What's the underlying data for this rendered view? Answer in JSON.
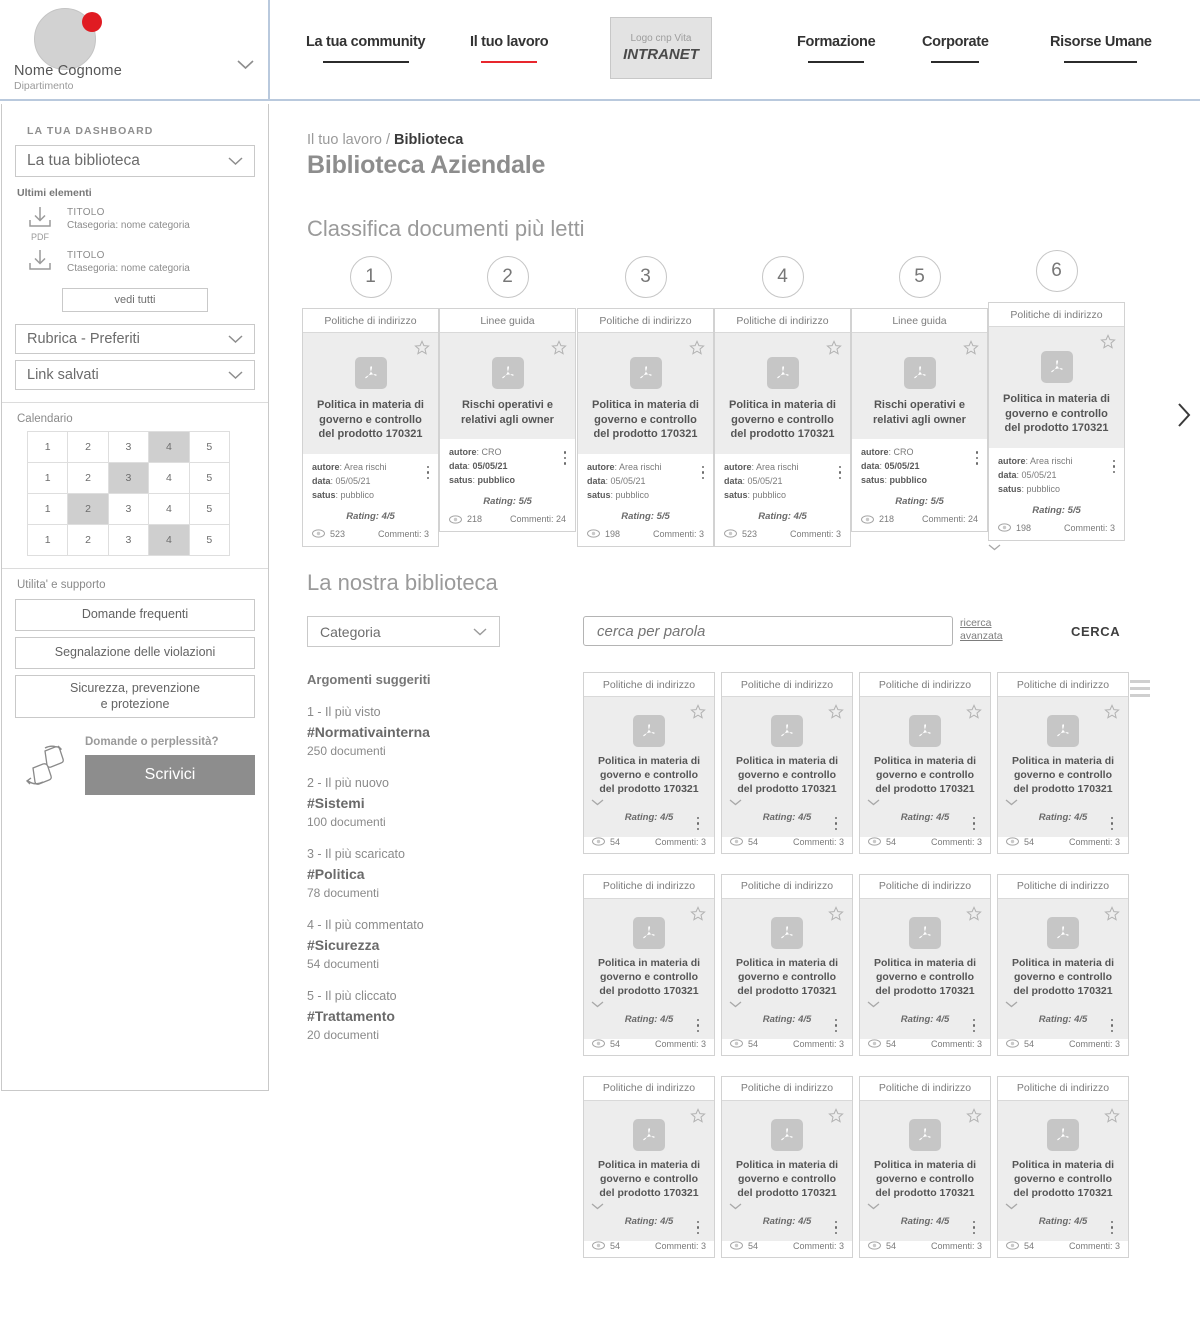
{
  "header": {
    "user": {
      "name": "Nome Cognome",
      "department": "Dipartimento",
      "chevron_icon": "chevron-down-icon",
      "notification_dot_color": "#e01b22"
    },
    "logo": {
      "line1": "Logo cnp Vita",
      "line2": "INTRANET"
    },
    "nav": [
      {
        "label": "La tua community",
        "active": false
      },
      {
        "label": "Il tuo lavoro",
        "active": true
      },
      {
        "label": "Formazione",
        "active": false
      },
      {
        "label": "Corporate",
        "active": false
      },
      {
        "label": "Risorse Umane",
        "active": false
      }
    ],
    "active_underline_color": "#e8262d"
  },
  "sidebar": {
    "dashboard_label": "LA TUA DASHBOARD",
    "library_select": "La tua biblioteca",
    "latest_label": "Ultimi elementi",
    "latest_items": [
      {
        "icon": "download-icon",
        "caption": "PDF",
        "title": "TITOLO",
        "category": "Ctasegoria: nome categoria"
      },
      {
        "icon": "download-icon",
        "caption": "",
        "title": "TITOLO",
        "category": "Ctasegoria: nome categoria"
      }
    ],
    "see_all": "vedi tutti",
    "selects": [
      "Rubrica - Preferiti",
      "Link salvati"
    ],
    "calendar_label": "Calendario",
    "calendar_rows": [
      {
        "cells": [
          "1",
          "2",
          "3",
          "4",
          "5"
        ],
        "highlight": 3
      },
      {
        "cells": [
          "1",
          "2",
          "3",
          "4",
          "5"
        ],
        "highlight": 2
      },
      {
        "cells": [
          "1",
          "2",
          "3",
          "4",
          "5"
        ],
        "highlight": 1
      },
      {
        "cells": [
          "1",
          "2",
          "3",
          "4",
          "5"
        ],
        "highlight": 3
      }
    ],
    "utility_label": "Utilita' e supporto",
    "utility_buttons": [
      "Domande frequenti",
      "Segnalazione delle violazioni",
      "Sicurezza, prevenzione\ne protezione"
    ],
    "help_question": "Domande o perplessità?",
    "help_button": "Scrivici",
    "help_icon": "handshake-icon"
  },
  "main": {
    "breadcrumb_parent": "Il tuo lavoro / ",
    "breadcrumb_current": "Biblioteca",
    "page_title": "Biblioteca Aziendale",
    "ranking_title": "Classifica documenti più letti",
    "library_title": "La nostra biblioteca",
    "next_arrow_icon": "chevron-right-icon"
  },
  "search": {
    "category_label": "Categoria",
    "category_chevron_icon": "chevron-down-icon",
    "placeholder": "cerca per parola",
    "advanced_line1": "ricerca",
    "advanced_line2": "avanzata",
    "submit_label": "CERCA",
    "view_grid_icon": "grid-view-icon",
    "view_list_icon": "list-view-icon",
    "active_view": "grid"
  },
  "ranking": [
    {
      "num": "1",
      "category": "Politiche di indirizzo",
      "title": "Politica in materia di governo e controllo del prodotto 170321",
      "author_label": "autore",
      "author": "Area rischi",
      "date_label": "data",
      "date": "05/05/21",
      "status_label": "satus",
      "status": "pubblico",
      "bold_values": false,
      "rating": "Rating: 4/5",
      "views": "523",
      "comments": "Commenti: 3"
    },
    {
      "num": "2",
      "category": "Linee guida",
      "title": "Rischi operativi e relativi agli owner",
      "author_label": "autore",
      "author": "CRO",
      "date_label": "data",
      "date": "05/05/21",
      "status_label": "satus",
      "status": "pubblico",
      "bold_values": true,
      "rating": "Rating: 5/5",
      "views": "218",
      "comments": "Commenti: 24"
    },
    {
      "num": "3",
      "category": "Politiche di indirizzo",
      "title": "Politica in materia di governo e controllo del prodotto 170321",
      "author_label": "autore",
      "author": "Area rischi",
      "date_label": "data",
      "date": "05/05/21",
      "status_label": "satus",
      "status": "pubblico",
      "bold_values": false,
      "rating": "Rating: 5/5",
      "views": "198",
      "comments": "Commenti: 3"
    },
    {
      "num": "4",
      "category": "Politiche di indirizzo",
      "title": "Politica in materia di governo e controllo del prodotto 170321",
      "author_label": "autore",
      "author": "Area rischi",
      "date_label": "data",
      "date": "05/05/21",
      "status_label": "satus",
      "status": "pubblico",
      "bold_values": false,
      "rating": "Rating: 4/5",
      "views": "523",
      "comments": "Commenti: 3"
    },
    {
      "num": "5",
      "category": "Linee guida",
      "title": "Rischi operativi e relativi agli owner",
      "author_label": "autore",
      "author": "CRO",
      "date_label": "data",
      "date": "05/05/21",
      "status_label": "satus",
      "status": "pubblico",
      "bold_values": true,
      "rating": "Rating: 5/5",
      "views": "218",
      "comments": "Commenti: 24"
    },
    {
      "num": "6",
      "category": "Politiche di indirizzo",
      "title": "Politica in materia di governo e controllo del prodotto 170321",
      "author_label": "autore",
      "author": "Area rischi",
      "date_label": "data",
      "date": "05/05/21",
      "status_label": "satus",
      "status": "pubblico",
      "bold_values": false,
      "rating": "Rating: 5/5",
      "views": "198",
      "comments": "Commenti: 3"
    }
  ],
  "topics": {
    "heading": "Argomenti suggeriti",
    "items": [
      {
        "rank": "1 - Il più visto",
        "tag": "#Normativainterna",
        "count": "250 documenti"
      },
      {
        "rank": "2 - Il più nuovo",
        "tag": "#Sistemi",
        "count": "100 documenti"
      },
      {
        "rank": "3 - Il più scaricato",
        "tag": "#Politica",
        "count": "78 documenti"
      },
      {
        "rank": "4 - Il più commentato",
        "tag": "#Sicurezza",
        "count": "54 documenti"
      },
      {
        "rank": "5 - Il più cliccato",
        "tag": "#Trattamento",
        "count": "20 documenti"
      }
    ]
  },
  "documents": [
    {
      "category": "Politiche di indirizzo",
      "title": "Politica in materia di governo e controllo del prodotto 170321",
      "rating": "Rating: 4/5",
      "views": "54",
      "comments": "Commenti: 3"
    },
    {
      "category": "Politiche di indirizzo",
      "title": "Politica in materia di governo e controllo del prodotto 170321",
      "rating": "Rating: 4/5",
      "views": "54",
      "comments": "Commenti: 3"
    },
    {
      "category": "Politiche di indirizzo",
      "title": "Politica in materia di governo e controllo del prodotto 170321",
      "rating": "Rating: 4/5",
      "views": "54",
      "comments": "Commenti: 3"
    },
    {
      "category": "Politiche di indirizzo",
      "title": "Politica in materia di governo e controllo del prodotto 170321",
      "rating": "Rating: 4/5",
      "views": "54",
      "comments": "Commenti: 3"
    },
    {
      "category": "Politiche di indirizzo",
      "title": "Politica in materia di governo e controllo del prodotto 170321",
      "rating": "Rating: 4/5",
      "views": "54",
      "comments": "Commenti: 3"
    },
    {
      "category": "Politiche di indirizzo",
      "title": "Politica in materia di governo e controllo del prodotto 170321",
      "rating": "Rating: 4/5",
      "views": "54",
      "comments": "Commenti: 3"
    },
    {
      "category": "Politiche di indirizzo",
      "title": "Politica in materia di governo e controllo del prodotto 170321",
      "rating": "Rating: 4/5",
      "views": "54",
      "comments": "Commenti: 3"
    },
    {
      "category": "Politiche di indirizzo",
      "title": "Politica in materia di governo e controllo del prodotto 170321",
      "rating": "Rating: 4/5",
      "views": "54",
      "comments": "Commenti: 3"
    },
    {
      "category": "Politiche di indirizzo",
      "title": "Politica in materia di governo e controllo del prodotto 170321",
      "rating": "Rating: 4/5",
      "views": "54",
      "comments": "Commenti: 3"
    },
    {
      "category": "Politiche di indirizzo",
      "title": "Politica in materia di governo e controllo del prodotto 170321",
      "rating": "Rating: 4/5",
      "views": "54",
      "comments": "Commenti: 3"
    },
    {
      "category": "Politiche di indirizzo",
      "title": "Politica in materia di governo e controllo del prodotto 170321",
      "rating": "Rating: 4/5",
      "views": "54",
      "comments": "Commenti: 3"
    },
    {
      "category": "Politiche di indirizzo",
      "title": "Politica in materia di governo e controllo del prodotto 170321",
      "rating": "Rating: 4/5",
      "views": "54",
      "comments": "Commenti: 3"
    }
  ]
}
